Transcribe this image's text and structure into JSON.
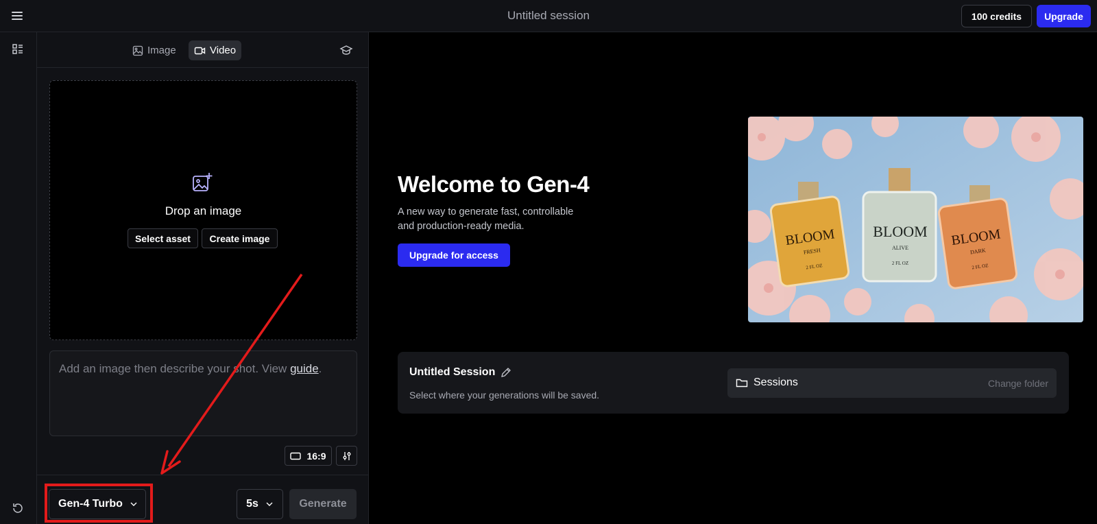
{
  "header": {
    "session_title": "Untitled session",
    "credits_label": "100 credits",
    "upgrade_label": "Upgrade"
  },
  "panel": {
    "tabs": [
      {
        "label": "Image",
        "icon": "image-icon",
        "active": false
      },
      {
        "label": "Video",
        "icon": "video-camera-icon",
        "active": true
      }
    ],
    "dropzone": {
      "title": "Drop an image",
      "select_asset_label": "Select asset",
      "create_image_label": "Create image"
    },
    "prompt": {
      "placeholder_text": "Add an image then describe your shot. View ",
      "guide_link": "guide",
      "suffix": "."
    },
    "aspect_ratio": "16:9",
    "model": "Gen-4 Turbo",
    "duration": "5s",
    "generate_label": "Generate"
  },
  "main": {
    "welcome_title": "Welcome to Gen-4",
    "welcome_desc": "A new way to generate fast, controllable and production-ready media.",
    "access_button": "Upgrade for access",
    "hero_image": {
      "bottles": [
        {
          "brand": "BLOOM",
          "variant": "FRESH",
          "size": "2 FL OZ",
          "color": "#e0a53a"
        },
        {
          "brand": "BLOOM",
          "variant": "ALIVE",
          "size": "2 FL OZ",
          "color": "#c9d3c8"
        },
        {
          "brand": "BLOOM",
          "variant": "DARK",
          "size": "2 FL OZ",
          "color": "#e08a4e"
        }
      ]
    },
    "session_card": {
      "title": "Untitled Session",
      "description": "Select where your generations will be saved.",
      "folder_label": "Sessions",
      "change_folder_label": "Change folder"
    }
  },
  "colors": {
    "accent": "#2b2bf0",
    "annotation": "#e31b1b"
  }
}
